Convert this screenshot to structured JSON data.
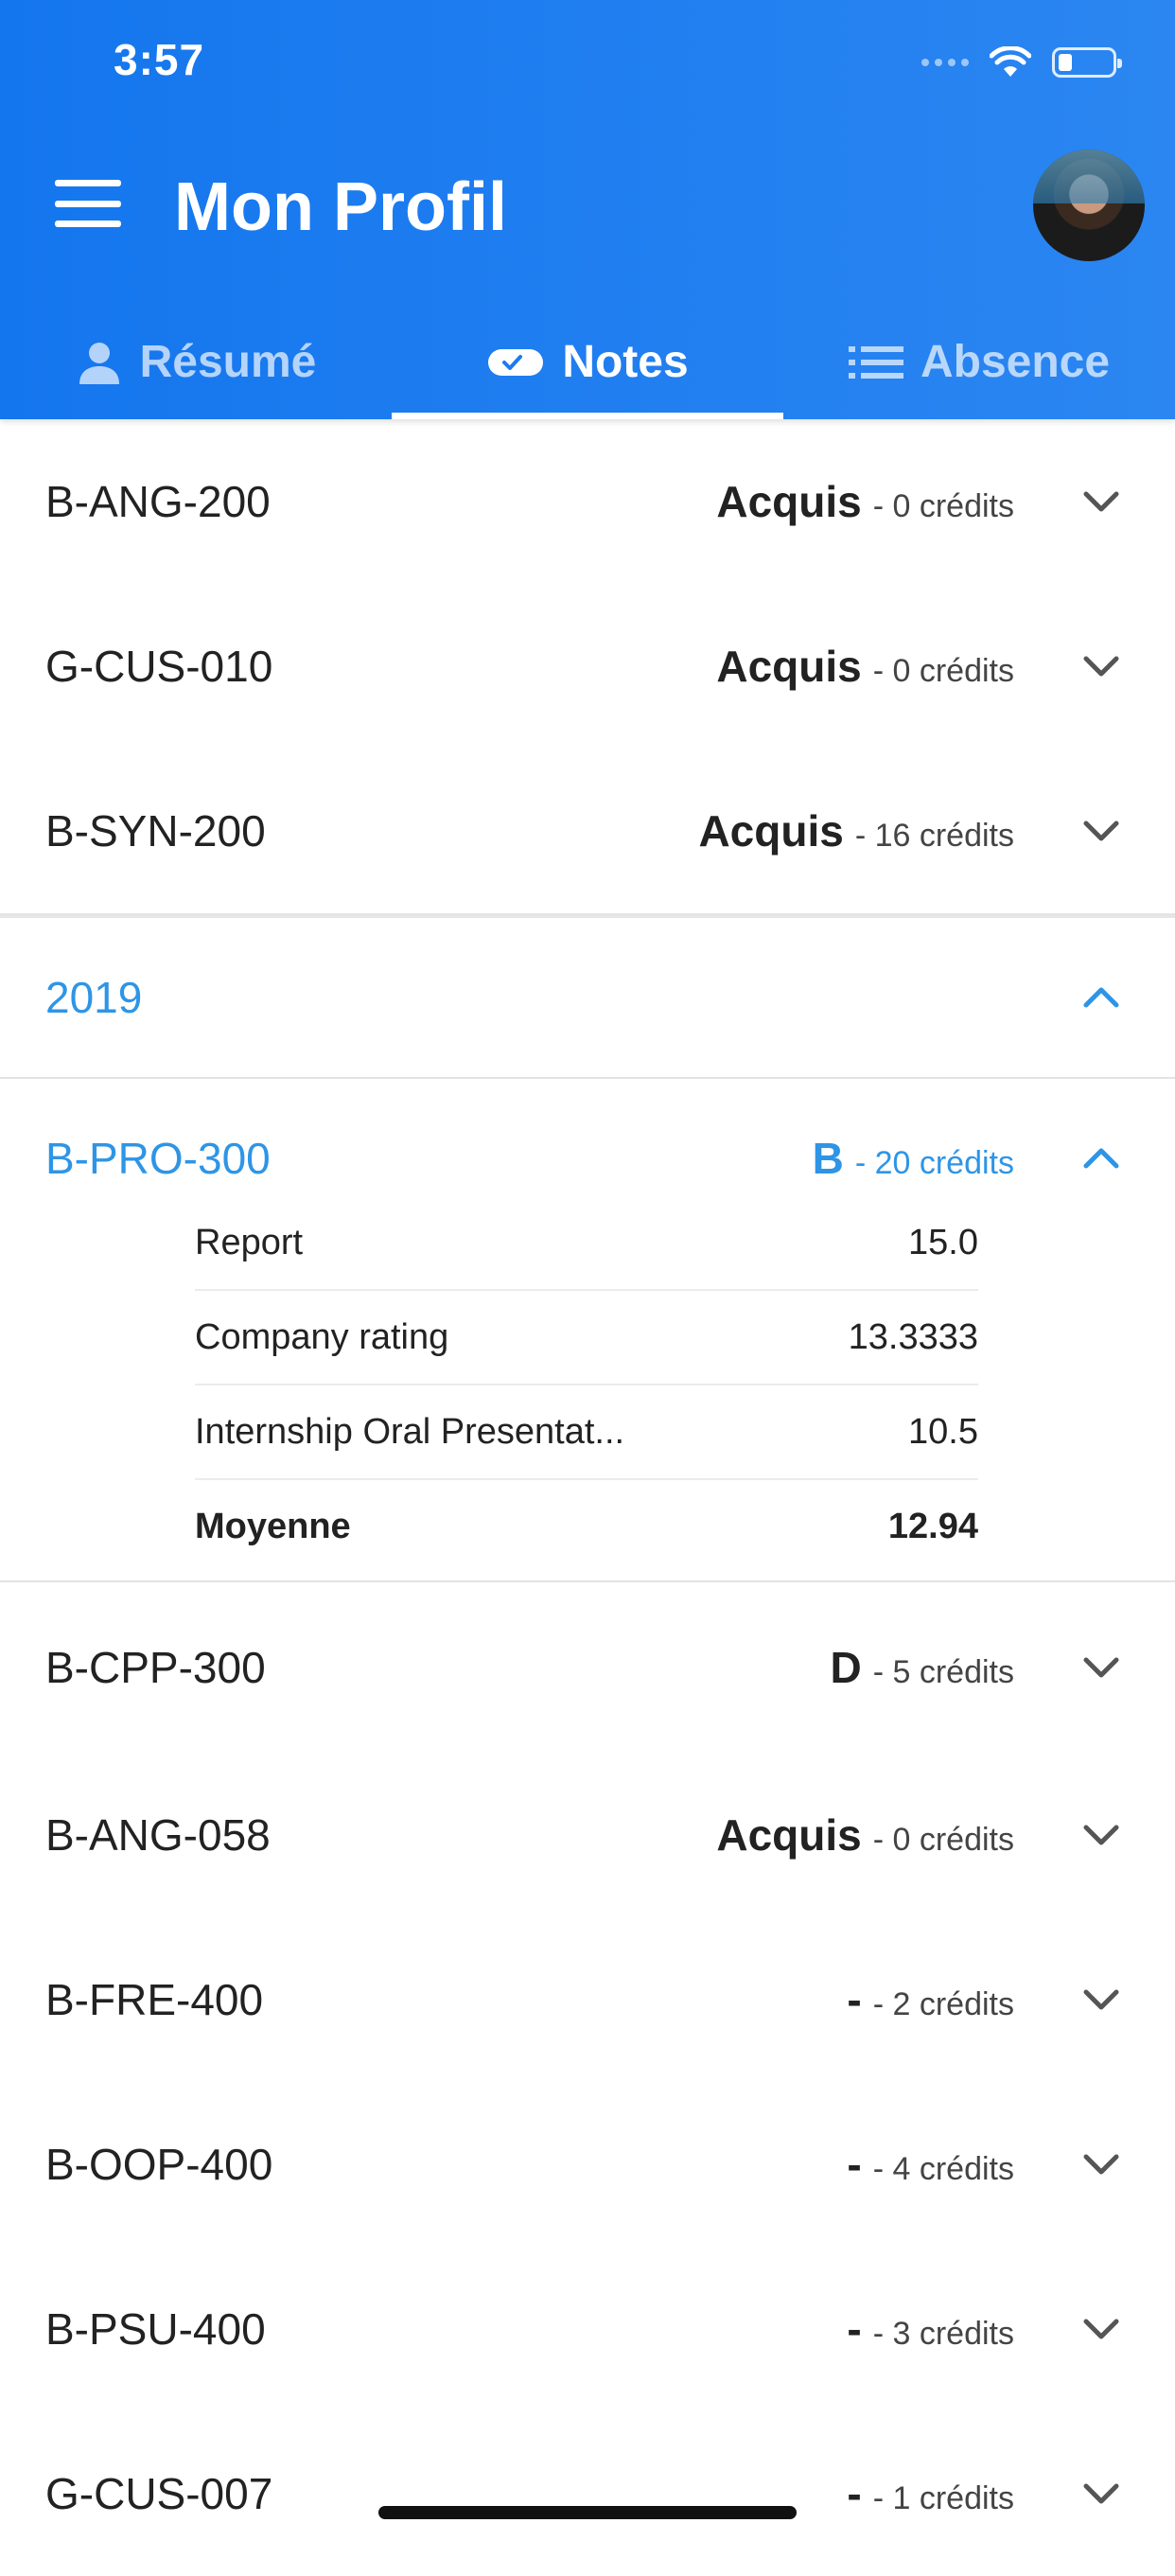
{
  "status_bar": {
    "time": "3:57"
  },
  "header": {
    "title": "Mon Profil"
  },
  "tabs": [
    {
      "label": "Résumé",
      "icon": "person-icon",
      "active": false
    },
    {
      "label": "Notes",
      "icon": "pill-check-icon",
      "active": true
    },
    {
      "label": "Absence",
      "icon": "list-icon",
      "active": false
    }
  ],
  "courses_top": [
    {
      "code": "B-ANG-200",
      "grade": "Acquis",
      "credits": "- 0 crédits"
    },
    {
      "code": "G-CUS-010",
      "grade": "Acquis",
      "credits": "- 0 crédits"
    },
    {
      "code": "B-SYN-200",
      "grade": "Acquis",
      "credits": "- 16 crédits"
    }
  ],
  "year_section": {
    "label": "2019"
  },
  "expanded_course": {
    "code": "B-PRO-300",
    "grade": "B",
    "credits": "- 20 crédits",
    "details": [
      {
        "name": "Report",
        "value": "15.0"
      },
      {
        "name": "Company rating",
        "value": "13.3333"
      },
      {
        "name": "Internship Oral Presentat...",
        "value": "10.5"
      },
      {
        "name": "Moyenne",
        "value": "12.94"
      }
    ]
  },
  "courses_bottom": [
    {
      "code": "B-CPP-300",
      "grade": "D",
      "credits": "- 5 crédits"
    },
    {
      "code": "B-ANG-058",
      "grade": "Acquis",
      "credits": "- 0 crédits"
    },
    {
      "code": "B-FRE-400",
      "grade": "-",
      "credits": "- 2 crédits"
    },
    {
      "code": "B-OOP-400",
      "grade": "-",
      "credits": "- 4 crédits"
    },
    {
      "code": "B-PSU-400",
      "grade": "-",
      "credits": "- 3 crédits"
    },
    {
      "code": "G-CUS-007",
      "grade": "-",
      "credits": "- 1 crédits"
    }
  ],
  "colors": {
    "header_blue": "#1a7cf0",
    "accent_blue": "#2e95e6"
  }
}
